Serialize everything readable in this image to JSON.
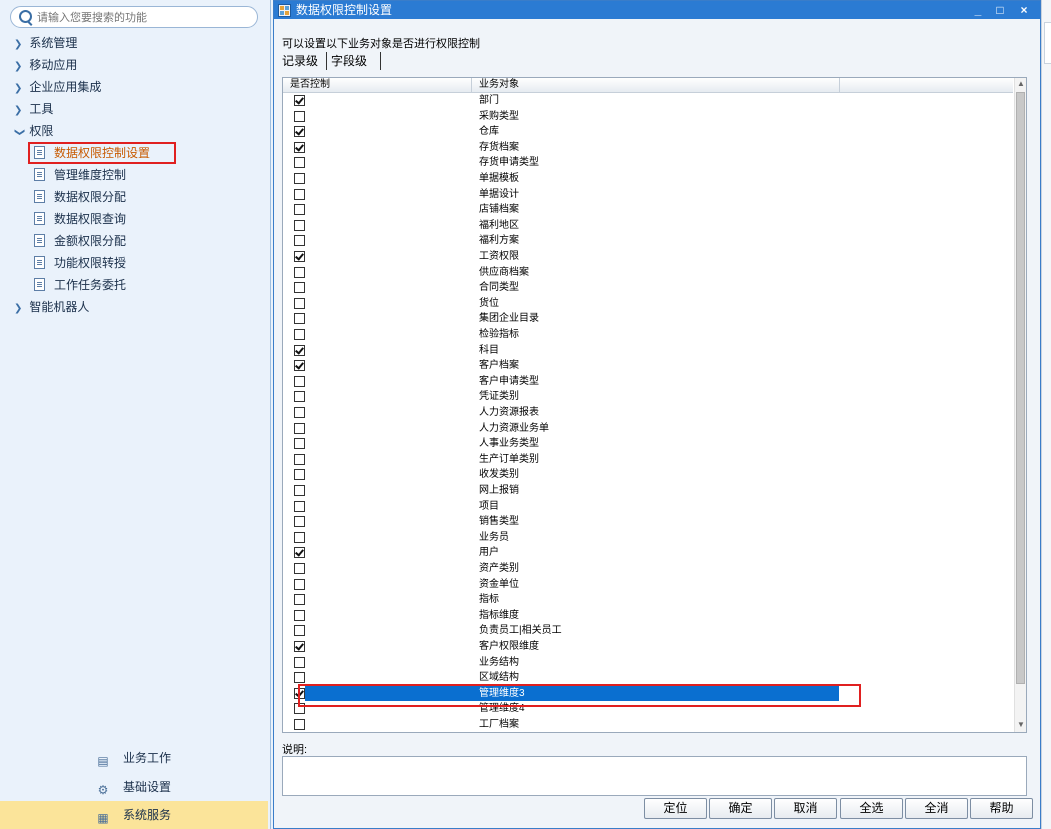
{
  "sidebar": {
    "search_placeholder": "请输入您要搜索的功能",
    "menu": [
      {
        "label": "系统管理",
        "expanded": false
      },
      {
        "label": "移动应用",
        "expanded": false
      },
      {
        "label": "企业应用集成",
        "expanded": false
      },
      {
        "label": "工具",
        "expanded": false
      },
      {
        "label": "权限",
        "expanded": true
      },
      {
        "label": "智能机器人",
        "expanded": false
      }
    ],
    "submenu": [
      {
        "label": "数据权限控制设置",
        "selected": true
      },
      {
        "label": "管理维度控制"
      },
      {
        "label": "数据权限分配"
      },
      {
        "label": "数据权限查询"
      },
      {
        "label": "金额权限分配"
      },
      {
        "label": "功能权限转授"
      },
      {
        "label": "工作任务委托"
      }
    ],
    "bottom": [
      {
        "label": "业务工作",
        "icon": "business-icon"
      },
      {
        "label": "基础设置",
        "icon": "gear-icon"
      },
      {
        "label": "系统服务",
        "icon": "service-icon",
        "active": true
      }
    ]
  },
  "dialog": {
    "title": "数据权限控制设置",
    "window_buttons": {
      "minimize": "_",
      "maximize": "□",
      "close": "×"
    },
    "intro": "可以设置以下业务对象是否进行权限控制",
    "tabs": [
      "记录级",
      "字段级"
    ],
    "columns": [
      "是否控制",
      "业务对象"
    ],
    "rows": [
      {
        "checked": true,
        "name": "部门"
      },
      {
        "checked": false,
        "name": "采购类型"
      },
      {
        "checked": true,
        "name": "仓库"
      },
      {
        "checked": true,
        "name": "存货档案"
      },
      {
        "checked": false,
        "name": "存货申请类型"
      },
      {
        "checked": false,
        "name": "单据模板"
      },
      {
        "checked": false,
        "name": "单据设计"
      },
      {
        "checked": false,
        "name": "店铺档案"
      },
      {
        "checked": false,
        "name": "福利地区"
      },
      {
        "checked": false,
        "name": "福利方案"
      },
      {
        "checked": true,
        "name": "工资权限"
      },
      {
        "checked": false,
        "name": "供应商档案"
      },
      {
        "checked": false,
        "name": "合同类型"
      },
      {
        "checked": false,
        "name": "货位"
      },
      {
        "checked": false,
        "name": "集团企业目录"
      },
      {
        "checked": false,
        "name": "检验指标"
      },
      {
        "checked": true,
        "name": "科目"
      },
      {
        "checked": true,
        "name": "客户档案"
      },
      {
        "checked": false,
        "name": "客户申请类型"
      },
      {
        "checked": false,
        "name": "凭证类别"
      },
      {
        "checked": false,
        "name": "人力资源报表"
      },
      {
        "checked": false,
        "name": "人力资源业务单"
      },
      {
        "checked": false,
        "name": "人事业务类型"
      },
      {
        "checked": false,
        "name": "生产订单类别"
      },
      {
        "checked": false,
        "name": "收发类别"
      },
      {
        "checked": false,
        "name": "网上报销"
      },
      {
        "checked": false,
        "name": "项目"
      },
      {
        "checked": false,
        "name": "销售类型"
      },
      {
        "checked": false,
        "name": "业务员"
      },
      {
        "checked": true,
        "name": "用户"
      },
      {
        "checked": false,
        "name": "资产类别"
      },
      {
        "checked": false,
        "name": "资金单位"
      },
      {
        "checked": false,
        "name": "指标"
      },
      {
        "checked": false,
        "name": "指标维度"
      },
      {
        "checked": false,
        "name": "负责员工|相关员工"
      },
      {
        "checked": true,
        "name": "客户权限维度"
      },
      {
        "checked": false,
        "name": "业务结构"
      },
      {
        "checked": false,
        "name": "区域结构"
      },
      {
        "checked": true,
        "name": "管理维度3",
        "selected": true
      },
      {
        "checked": false,
        "name": "管理维度4"
      },
      {
        "checked": false,
        "name": "工厂档案"
      }
    ],
    "note_label": "说明:",
    "buttons": [
      "定位",
      "确定",
      "取消",
      "全选",
      "全消",
      "帮助"
    ]
  }
}
